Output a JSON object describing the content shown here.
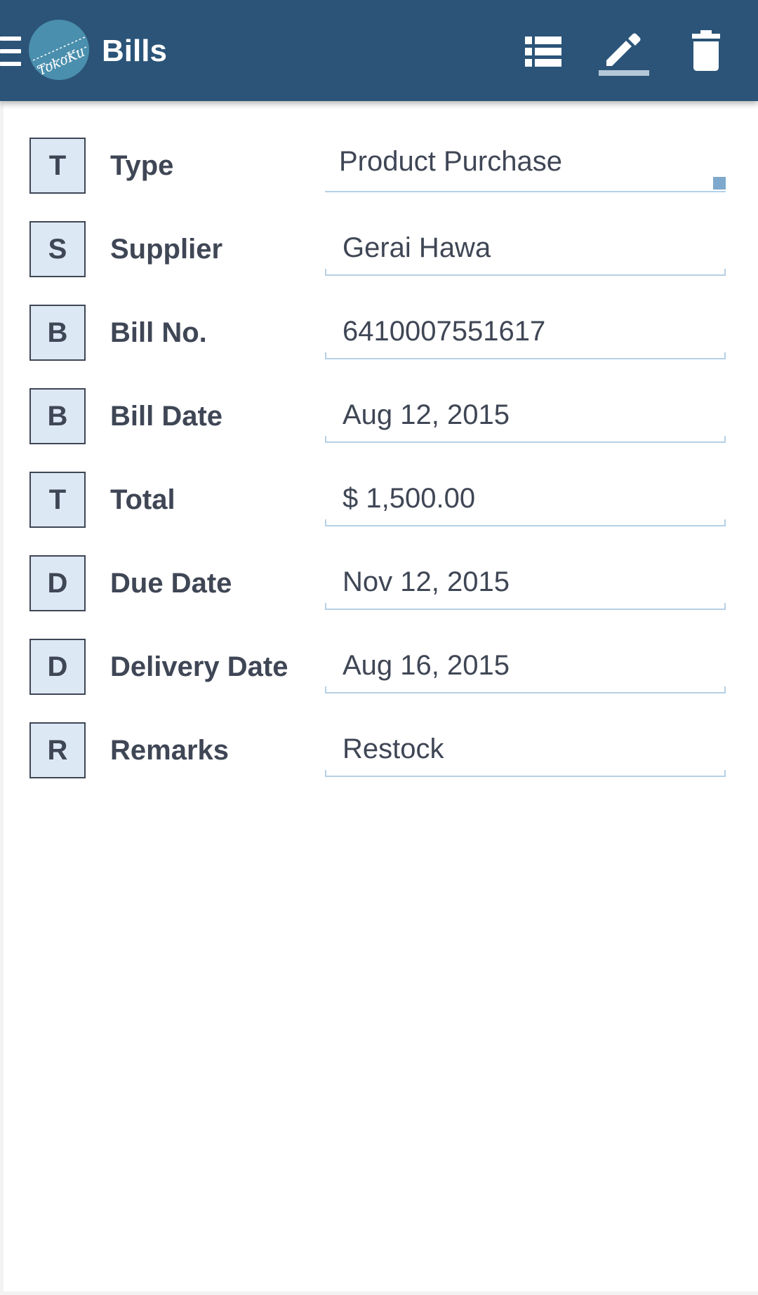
{
  "app": {
    "title": "Bills",
    "logo_text": "TokoKu",
    "brand_color": "#2b5478"
  },
  "toolbar": {
    "icons": [
      "list-icon",
      "edit-icon",
      "delete-icon"
    ],
    "active": "edit-icon"
  },
  "form": {
    "fields": [
      {
        "initial": "T",
        "label": "Type",
        "value": "Product Purchase"
      },
      {
        "initial": "S",
        "label": "Supplier",
        "value": "Gerai Hawa"
      },
      {
        "initial": "B",
        "label": "Bill No.",
        "value": "6410007551617"
      },
      {
        "initial": "B",
        "label": "Bill Date",
        "value": "Aug 12, 2015"
      },
      {
        "initial": "T",
        "label": "Total",
        "value": "$ 1,500.00"
      },
      {
        "initial": "D",
        "label": "Due Date",
        "value": "Nov 12, 2015"
      },
      {
        "initial": "D",
        "label": "Delivery Date",
        "value": "Aug 16, 2015"
      },
      {
        "initial": "R",
        "label": "Remarks",
        "value": "Restock"
      }
    ]
  }
}
